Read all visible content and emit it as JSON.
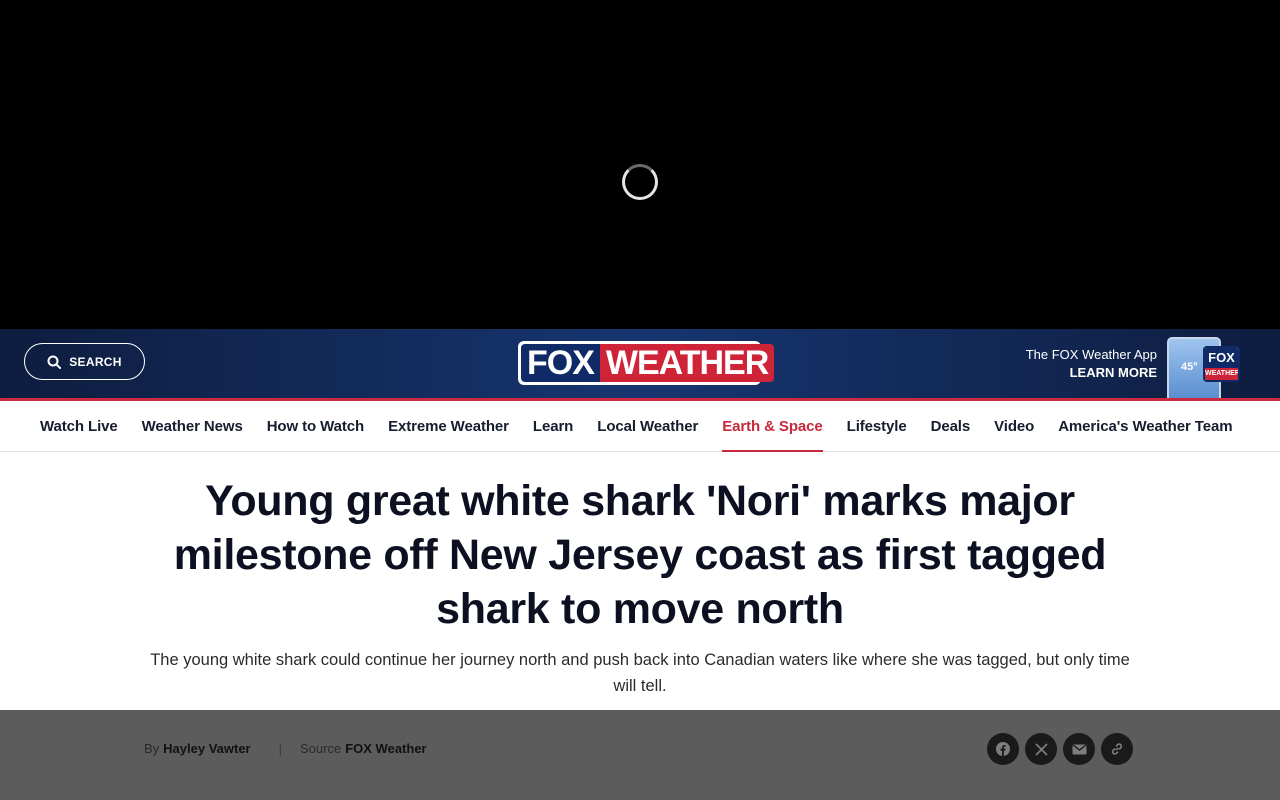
{
  "header": {
    "search_label": "SEARCH",
    "logo_fox": "FOX",
    "logo_weather": "WEATHER",
    "app_promo_line1": "The FOX Weather App",
    "app_promo_line2": "LEARN MORE",
    "phone_temp": "45°",
    "badge_fox": "FOX",
    "badge_weather": "WEATHER"
  },
  "nav": {
    "items": [
      {
        "label": "Watch Live"
      },
      {
        "label": "Weather News"
      },
      {
        "label": "How to Watch"
      },
      {
        "label": "Extreme Weather"
      },
      {
        "label": "Learn"
      },
      {
        "label": "Local Weather"
      },
      {
        "label": "Earth & Space",
        "active": true
      },
      {
        "label": "Lifestyle"
      },
      {
        "label": "Deals"
      },
      {
        "label": "Video"
      },
      {
        "label": "America's Weather Team"
      }
    ]
  },
  "article": {
    "headline": "Young great white shark 'Nori' marks major milestone off New Jersey coast as first tagged shark to move north",
    "dek": "The young white shark could continue her journey north and push back into Canadian waters like where she was tagged, but only time will tell.",
    "by_prefix": "By",
    "author": "Hayley Vawter",
    "separator": "|",
    "source_prefix": "Source",
    "source": "FOX Weather"
  },
  "colors": {
    "brand_navy": "#0f2a66",
    "brand_red": "#cf2437",
    "nav_active": "#c8283b"
  },
  "icons": [
    "search-icon",
    "facebook-icon",
    "x-icon",
    "email-icon",
    "link-icon"
  ]
}
